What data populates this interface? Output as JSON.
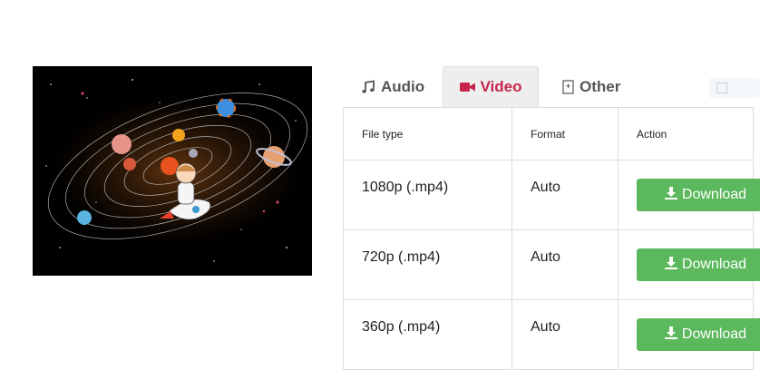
{
  "tabs": {
    "audio": "Audio",
    "video": "Video",
    "other": "Other"
  },
  "table": {
    "headers": [
      "File type",
      "Format",
      "Action"
    ],
    "rows": [
      {
        "file_type": "1080p (.mp4)",
        "format": "Auto",
        "action": "Download"
      },
      {
        "file_type": "720p (.mp4)",
        "format": "Auto",
        "action": "Download"
      },
      {
        "file_type": "360p (.mp4)",
        "format": "Auto",
        "action": "Download"
      }
    ]
  },
  "colors": {
    "active_tab": "#c7254e",
    "download_button": "#5cb85c",
    "thumbnail_background": "#000000"
  },
  "icons": {
    "audio": "music-icon",
    "video": "video-camera-icon",
    "other": "file-icon",
    "download": "download-icon"
  }
}
